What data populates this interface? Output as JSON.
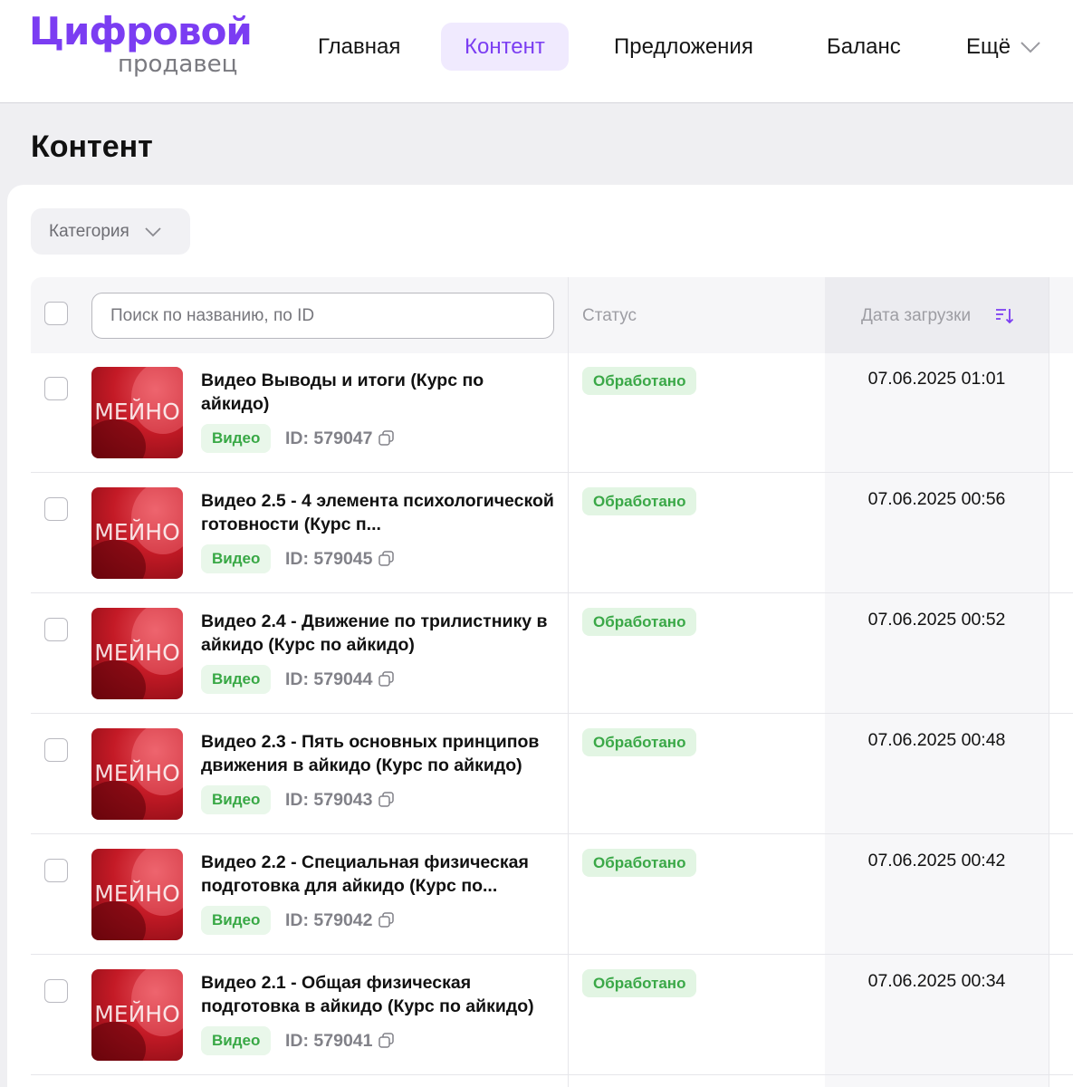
{
  "header": {
    "logo_main": "Цифровой",
    "logo_sub": "продавец",
    "nav": [
      {
        "label": "Главная",
        "active": false
      },
      {
        "label": "Контент",
        "active": true
      },
      {
        "label": "Предложения",
        "active": false
      },
      {
        "label": "Баланс",
        "active": false
      },
      {
        "label": "Ещё",
        "active": false
      }
    ]
  },
  "page": {
    "title": "Контент"
  },
  "filters": {
    "category_label": "Категория"
  },
  "table": {
    "search_placeholder": "Поиск по названию, по ID",
    "columns": {
      "status": "Статус",
      "upload_date": "Дата загрузки"
    },
    "rows": [
      {
        "title": "Видео Выводы и итоги (Курс по айкидо)",
        "type": "Видео",
        "id": "ID: 579047",
        "status": "Обработано",
        "date": "07.06.2025 01:01",
        "thumb_text": "МЕЙНО"
      },
      {
        "title": "Видео 2.5 - 4 элемента психологической готовности (Курс п...",
        "type": "Видео",
        "id": "ID: 579045",
        "status": "Обработано",
        "date": "07.06.2025 00:56",
        "thumb_text": "МЕЙНО"
      },
      {
        "title": "Видео 2.4 - Движение по трилистнику в айкидо (Курс по айкидо)",
        "type": "Видео",
        "id": "ID: 579044",
        "status": "Обработано",
        "date": "07.06.2025 00:52",
        "thumb_text": "МЕЙНО"
      },
      {
        "title": "Видео 2.3 - Пять основных принципов движения в айкидо (Курс по айкидо)",
        "type": "Видео",
        "id": "ID: 579043",
        "status": "Обработано",
        "date": "07.06.2025 00:48",
        "thumb_text": "МЕЙНО"
      },
      {
        "title": "Видео 2.2 - Специальная физическая подготовка для айкидо (Курс по...",
        "type": "Видео",
        "id": "ID: 579042",
        "status": "Обработано",
        "date": "07.06.2025 00:42",
        "thumb_text": "МЕЙНО"
      },
      {
        "title": "Видео 2.1 - Общая физическая подготовка в айкидо (Курс по айкидо)",
        "type": "Видео",
        "id": "ID: 579041",
        "status": "Обработано",
        "date": "07.06.2025 00:34",
        "thumb_text": "МЕЙНО"
      }
    ]
  },
  "colors": {
    "accent": "#7b3df2",
    "status_green": "#3aa847",
    "badge_bg": "#e2f5e3"
  },
  "icons": {
    "nav_more": "chevron-down-icon",
    "filter": "chevron-down-icon",
    "sort": "sort-descending-icon",
    "copy": "copy-icon"
  }
}
